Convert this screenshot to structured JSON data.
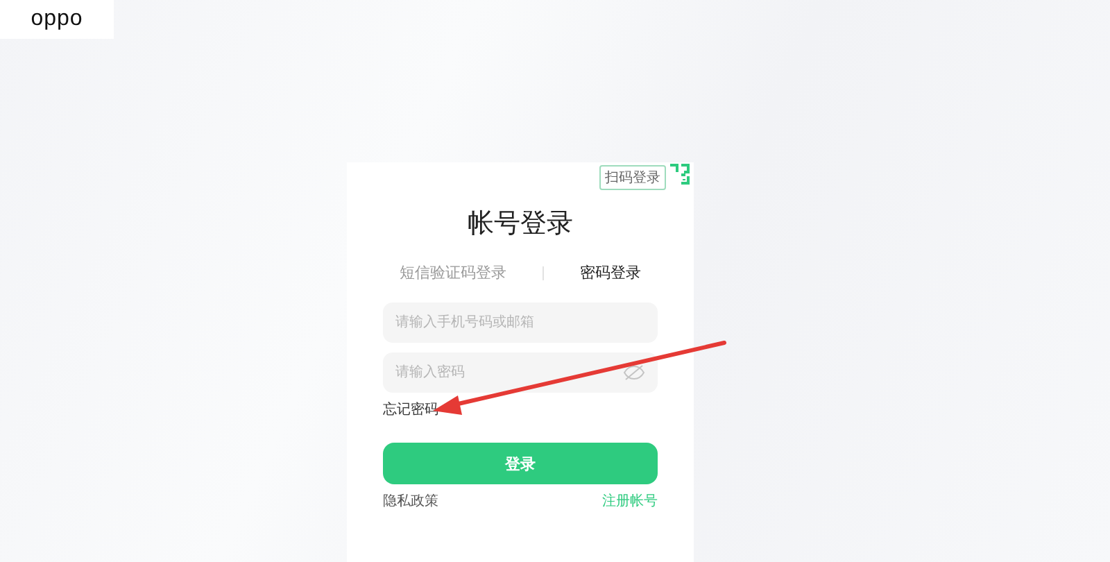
{
  "logo": {
    "text": "oppo"
  },
  "login_card": {
    "qr_login_tag": "扫码登录",
    "title": "帐号登录",
    "tabs": [
      {
        "label": "短信验证码登录",
        "selected": false
      },
      {
        "label": "密码登录",
        "selected": true
      }
    ],
    "fields": [
      {
        "placeholder": "请输入手机号码或邮箱",
        "kind": "text"
      },
      {
        "placeholder": "请输入密码",
        "kind": "password"
      }
    ],
    "forgot_password": "忘记密码",
    "login_button": "登录",
    "privacy_policy": "隐私政策",
    "register": "注册帐号"
  }
}
